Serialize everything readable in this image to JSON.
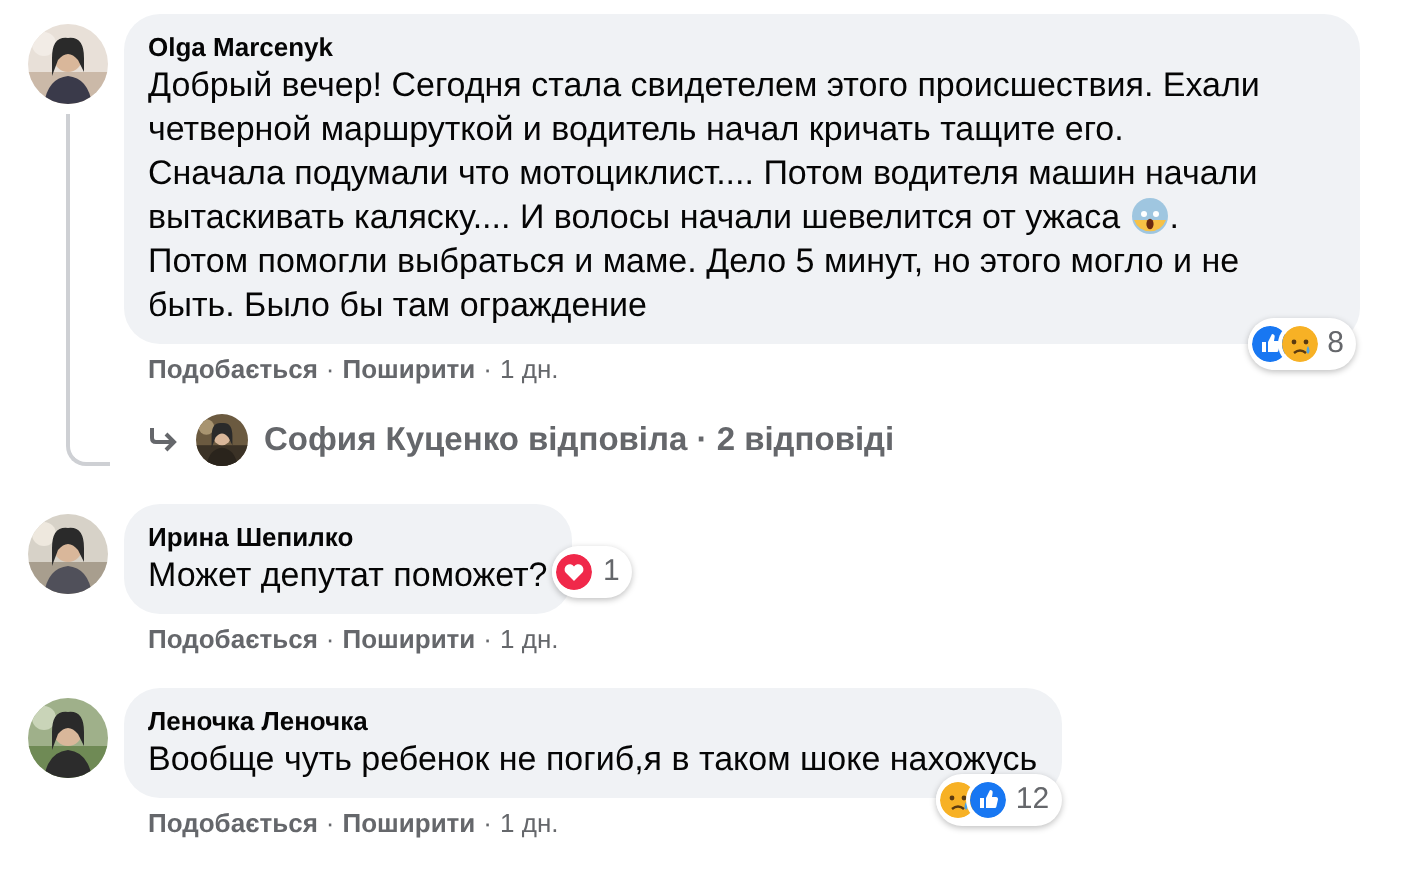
{
  "comments": [
    {
      "author": "Olga Marcenyk",
      "body": [
        {
          "kind": "text",
          "text": "Добрый вечер! Сегодня стала свидетелем этого происшествия. Ехали четверной маршруткой и водитель начал кричать тащите его. Сначала подумали что мотоциклист.... Потом водителя машин начали вытаскивать каляску.... И волосы начали шевелится от ужаса "
        },
        {
          "kind": "emoji"
        },
        {
          "kind": "text",
          "text": ". Потом помогли выбраться и маме. Дело 5 минут, но этого могло и не быть. Было бы там ограждение"
        }
      ],
      "reactions": [
        {
          "kind": "like"
        },
        {
          "kind": "sad"
        }
      ],
      "reaction_count": "8",
      "footer": [
        {
          "kind": "link",
          "text": "Подобається"
        },
        {
          "kind": "dot",
          "text": "·"
        },
        {
          "kind": "link",
          "text": "Поширити"
        },
        {
          "kind": "dot",
          "text": "·"
        },
        {
          "kind": "time",
          "text": "1 дн."
        }
      ],
      "replies": {
        "text": "София Куценко відповіла · 2 відповіді"
      }
    },
    {
      "author": "Ирина Шепилко",
      "body": [
        {
          "kind": "text",
          "text": "Может депутат поможет?"
        }
      ],
      "reactions": [
        {
          "kind": "love"
        }
      ],
      "reaction_count": "1",
      "footer": [
        {
          "kind": "link",
          "text": "Подобається"
        },
        {
          "kind": "dot",
          "text": "·"
        },
        {
          "kind": "link",
          "text": "Поширити"
        },
        {
          "kind": "dot",
          "text": "·"
        },
        {
          "kind": "time",
          "text": "1 дн."
        }
      ]
    },
    {
      "author": "Леночка Леночка",
      "body": [
        {
          "kind": "text",
          "text": "Вообще чуть ребенок не погиб,я в таком шоке нахожусь"
        }
      ],
      "reactions": [
        {
          "kind": "sad"
        },
        {
          "kind": "like"
        }
      ],
      "reaction_count": "12",
      "footer": [
        {
          "kind": "link",
          "text": "Подобається"
        },
        {
          "kind": "dot",
          "text": "·"
        },
        {
          "kind": "link",
          "text": "Поширити"
        },
        {
          "kind": "dot",
          "text": "·"
        },
        {
          "kind": "time",
          "text": "1 дн."
        }
      ]
    }
  ]
}
